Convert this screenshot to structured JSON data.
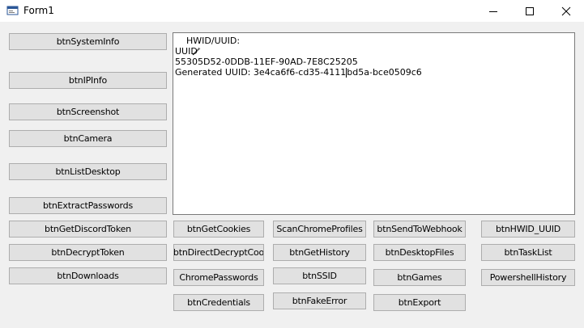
{
  "window": {
    "title": "Form1",
    "icon": "app-form-icon"
  },
  "output": {
    "lines": [
      "HWID/UUID:",
      "UUID",
      "55305D52-0DDB-11EF-90AD-7E8C25205",
      "Generated UUID: 3e4ca6f6-cd35-4111",
      "bd5a-bce0509c6"
    ],
    "line1_icon": "pencil-icon"
  },
  "buttons": {
    "system_info": "btnSystemInfo",
    "ip_info": "btnIPInfo",
    "screenshot": "btnScreenshot",
    "camera": "btnCamera",
    "list_desktop": "btnListDesktop",
    "extract_passwords": "btnExtractPasswords",
    "get_discord_token": "btnGetDiscordToken",
    "decrypt_token": "btnDecryptToken",
    "downloads": "btnDownloads",
    "get_cookies": "btnGetCookies",
    "direct_decrypt_coo": "btnDirectDecryptCoo",
    "chrome_passwords": "ChromePasswords",
    "credentials": "btnCredentials",
    "scan_chrome_profiles": "ScanChromeProfiles",
    "get_history": "btnGetHistory",
    "ssid": "btnSSID",
    "fake_error": "btnFakeError",
    "send_to_webhook": "btnSendToWebhook",
    "desktop_files": "btnDesktopFiles",
    "games": "btnGames",
    "export": "btnExport",
    "hwid_uuid": "btnHWID_UUID",
    "task_list": "btnTaskList",
    "powershell_history": "PowershellHistory"
  }
}
